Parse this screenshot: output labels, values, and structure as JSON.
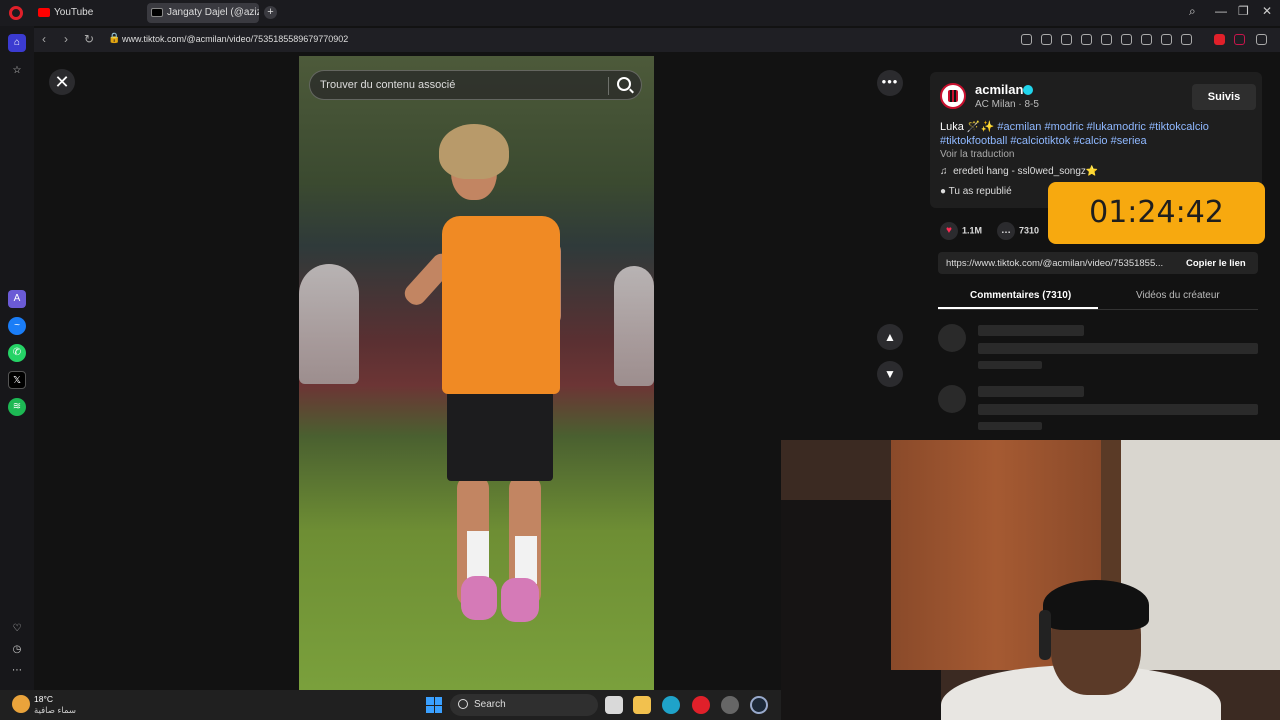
{
  "browser": {
    "tabs": [
      {
        "label": "YouTube"
      },
      {
        "label": "Jangaty Dajel (@azizy"
      }
    ],
    "new_tab": "+",
    "url": "www.tiktok.com/@acmilan/video/7535185589679770902"
  },
  "video": {
    "search_placeholder": "Trouver du contenu associé"
  },
  "post": {
    "username": "acmilan",
    "display_name": "AC Milan",
    "date": "8-5",
    "follow_label": "Suivis",
    "caption_text": "Luka 🪄✨",
    "caption_tags": "#acmilan #modric #lukamodric #tiktokcalcio #tiktokfootball #calciotiktok #calcio #seriea",
    "translate_label": "Voir la traduction",
    "music": "eredeti hang - ssl0wed_songz⭐",
    "repost_label": "Tu as republié",
    "likes": "1.1M",
    "comments_count": "7310",
    "share_link": "https://www.tiktok.com/@acmilan/video/75351855...",
    "copy_link_label": "Copier le lien",
    "tab_comments": "Commentaires (7310)",
    "tab_creator_videos": "Vidéos du créateur"
  },
  "timer": {
    "value": "01:24:42",
    "color": "#f7a90f"
  },
  "taskbar": {
    "temperature": "18°C",
    "weather_desc": "سماء صافية",
    "search_placeholder": "Search"
  },
  "colors": {
    "accent_link": "#8fb8ff",
    "opera_red": "#e0202a",
    "like_pink": "#fe2c55"
  }
}
